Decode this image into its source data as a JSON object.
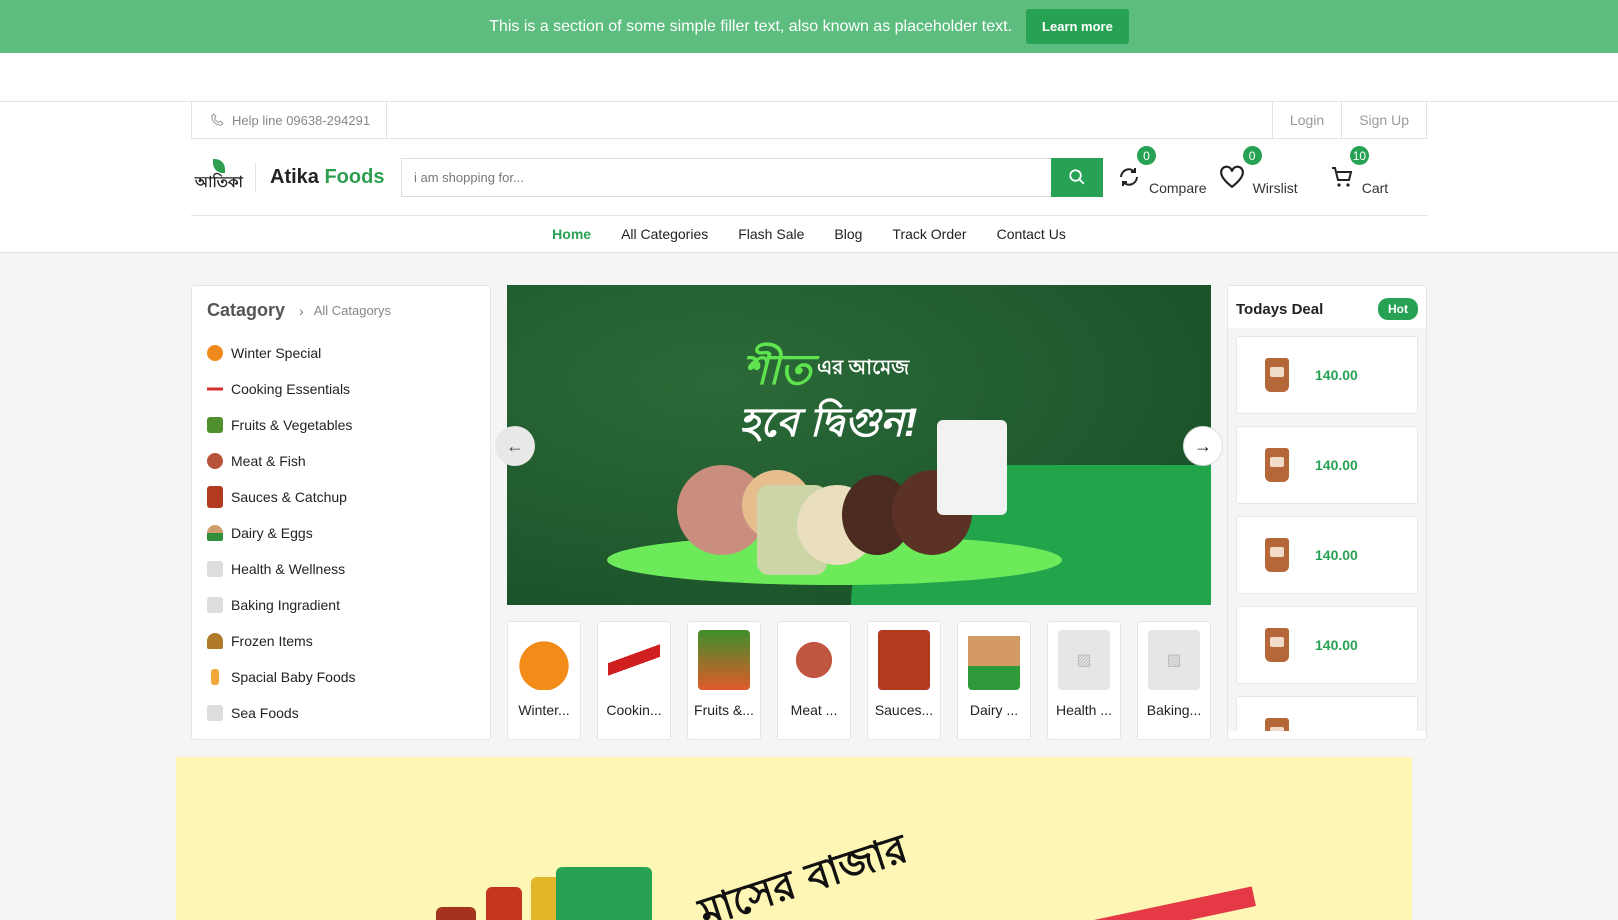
{
  "banner": {
    "text": "This is a section of some simple filler text, also known as placeholder text.",
    "button": "Learn more"
  },
  "topbar": {
    "helpline": "Help line 09638-294291",
    "login": "Login",
    "signup": "Sign Up"
  },
  "brand": {
    "logo_text": "আতিকা",
    "name_part1": "Atika",
    "name_part2": "Foods"
  },
  "search": {
    "placeholder": "i am shopping for..."
  },
  "header_icons": {
    "compare": {
      "label": "Compare",
      "count": "0"
    },
    "wishlist": {
      "label": "Wirslist",
      "count": "0"
    },
    "cart": {
      "label": "Cart",
      "count": "10"
    }
  },
  "nav": [
    "Home",
    "All Categories",
    "Flash Sale",
    "Blog",
    "Track Order",
    "Contact Us"
  ],
  "categories": {
    "title": "Catagory",
    "all_link": "All Catagorys",
    "items": [
      "Winter Special",
      "Cooking Essentials",
      "Fruits & Vegetables",
      "Meat & Fish",
      "Sauces & Catchup",
      "Dairy & Eggs",
      "Health & Wellness",
      "Baking Ingradient",
      "Frozen Items",
      "Spacial Baby Foods",
      "Sea Foods"
    ]
  },
  "slider": {
    "line1": "শীত",
    "line2": "এর আমেজ",
    "line3": "হবে দ্বিগুন!"
  },
  "thumbs": [
    "Winter...",
    "Cookin...",
    "Fruits &...",
    "Meat ...",
    "Sauces...",
    "Dairy ...",
    "Health ...",
    "Baking..."
  ],
  "deals": {
    "title": "Todays Deal",
    "badge": "Hot",
    "prices": [
      "140.00",
      "140.00",
      "140.00",
      "140.00"
    ]
  },
  "promo": {
    "text": "মাসের বাজার"
  },
  "colors": {
    "brand_green": "#27a254",
    "banner_green": "#5cbd7f",
    "promo_yellow": "#fef6b4"
  }
}
